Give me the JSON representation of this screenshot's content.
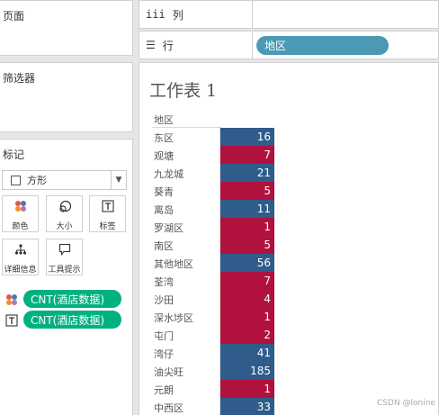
{
  "panels": {
    "pages_title": "页面",
    "filters_title": "筛选器",
    "marks_title": "标记"
  },
  "shelves": {
    "columns_label": "列",
    "rows_label": "行",
    "rows_pill": "地区"
  },
  "marks": {
    "mark_type": "方形",
    "buttons": [
      {
        "label": "颜色",
        "icon": "color-dots-icon"
      },
      {
        "label": "大小",
        "icon": "size-icon"
      },
      {
        "label": "标签",
        "icon": "text-label-icon"
      },
      {
        "label": "详细信息",
        "icon": "detail-icon"
      },
      {
        "label": "工具提示",
        "icon": "tooltip-icon"
      }
    ],
    "encodings": [
      {
        "field": "CNT(酒店数据)",
        "icon": "color-dots-icon"
      },
      {
        "field": "CNT(酒店数据)",
        "icon": "text-label-icon"
      }
    ]
  },
  "sheet": {
    "title": "工作表 1",
    "field_header": "地区",
    "colors": {
      "high": "#2f5c8a",
      "low": "#b0123d"
    },
    "rows": [
      {
        "region": "东区",
        "count": "16",
        "color": "#2f5c8a"
      },
      {
        "region": "观塘",
        "count": "7",
        "color": "#b0123d"
      },
      {
        "region": "九龙城",
        "count": "21",
        "color": "#2f5c8a"
      },
      {
        "region": "葵青",
        "count": "5",
        "color": "#b0123d"
      },
      {
        "region": "离岛",
        "count": "11",
        "color": "#2f5c8a"
      },
      {
        "region": "罗湖区",
        "count": "1",
        "color": "#b0123d"
      },
      {
        "region": "南区",
        "count": "5",
        "color": "#b0123d"
      },
      {
        "region": "其他地区",
        "count": "56",
        "color": "#2f5c8a"
      },
      {
        "region": "荃湾",
        "count": "7",
        "color": "#b0123d"
      },
      {
        "region": "沙田",
        "count": "4",
        "color": "#b0123d"
      },
      {
        "region": "深水埗区",
        "count": "1",
        "color": "#b0123d"
      },
      {
        "region": "屯门",
        "count": "2",
        "color": "#b0123d"
      },
      {
        "region": "湾仔",
        "count": "41",
        "color": "#2f5c8a"
      },
      {
        "region": "油尖旺",
        "count": "185",
        "color": "#2f5c8a"
      },
      {
        "region": "元朗",
        "count": "1",
        "color": "#b0123d"
      },
      {
        "region": "中西区",
        "count": "33",
        "color": "#2f5c8a"
      }
    ]
  },
  "watermark": "CSDN @lonine"
}
